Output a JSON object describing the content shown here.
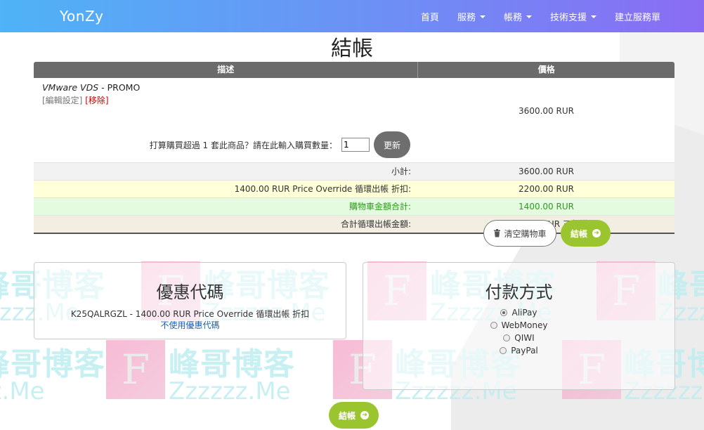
{
  "header": {
    "brand": "YonZy",
    "nav": [
      {
        "label": "首頁",
        "dropdown": false
      },
      {
        "label": "服務",
        "dropdown": true
      },
      {
        "label": "帳務",
        "dropdown": true
      },
      {
        "label": "技術支援",
        "dropdown": true
      },
      {
        "label": "建立服務單",
        "dropdown": false
      }
    ]
  },
  "page_title": "結帳",
  "cart": {
    "columns": [
      "描述",
      "價格"
    ],
    "item": {
      "product": "VMware VDS",
      "separator": " - ",
      "plan": "PROMO",
      "edit_link": "[編輯設定]",
      "remove_link": "[移除]",
      "price": "3600.00 RUR",
      "qty_prompt": "打算購買超過 1 套此商品？請在此輸入購買數量：",
      "qty_value": "1",
      "update_label": "更新"
    },
    "summary": [
      {
        "label": "小計:",
        "value": "3600.00 RUR"
      },
      {
        "label": "1400.00 RUR Price Override 循環出帳 折扣:",
        "value": "2200.00 RUR"
      },
      {
        "label": "購物車金額合計:",
        "value": "1400.00 RUR"
      },
      {
        "label": "合計循環出帳金額:",
        "value": "1400.00 RUR 三年繳"
      }
    ],
    "empty_cart_label": "清空購物車",
    "checkout_label": "結帳"
  },
  "promo": {
    "title": "優惠代碼",
    "applied": "K25QALRGZL - 1400.00 RUR Price Override 循環出帳 折扣",
    "remove_label": "不使用優惠代碼"
  },
  "payment": {
    "title": "付款方式",
    "options": [
      {
        "label": "AliPay",
        "selected": true
      },
      {
        "label": "WebMoney",
        "selected": false
      },
      {
        "label": "QIWI",
        "selected": false
      },
      {
        "label": "PayPal",
        "selected": false
      }
    ]
  },
  "checkout_bottom_label": "結帳",
  "watermark": {
    "cn": "峰哥博客",
    "url": "Zzzzzz.Me",
    "letter": "F"
  },
  "colors": {
    "accent_green": "#9bc52e",
    "header_start": "#4fb3f6",
    "header_end": "#8a6cf3"
  }
}
